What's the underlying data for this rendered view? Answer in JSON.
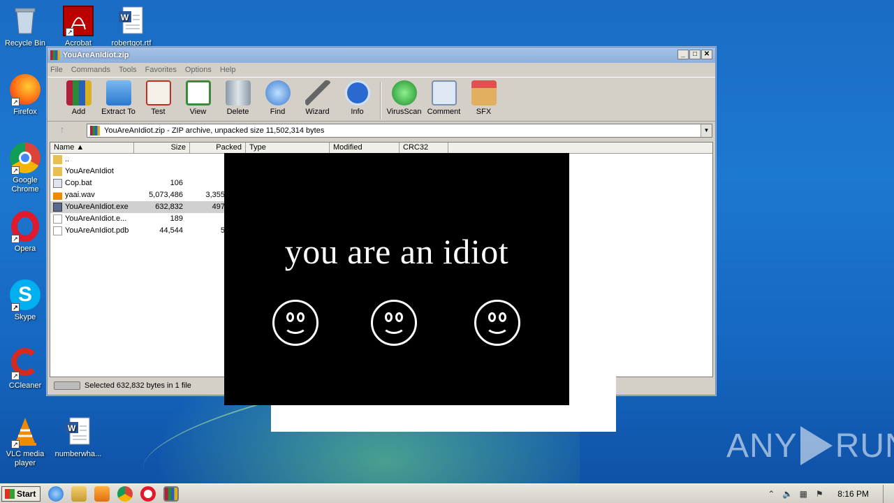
{
  "desktop": {
    "icons": [
      {
        "label": "Recycle Bin"
      },
      {
        "label": "Acrobat"
      },
      {
        "label": "robertgot.rtf"
      },
      {
        "label": "Firefox"
      },
      {
        "label": "Google Chrome"
      },
      {
        "label": "Opera"
      },
      {
        "label": "Skype"
      },
      {
        "label": "CCleaner"
      },
      {
        "label": "VLC media player"
      },
      {
        "label": "numberwha..."
      }
    ]
  },
  "window": {
    "title": "YouAreAnIdiot.zip",
    "menu": [
      "File",
      "Commands",
      "Tools",
      "Favorites",
      "Options",
      "Help"
    ],
    "toolbar": [
      "Add",
      "Extract To",
      "Test",
      "View",
      "Delete",
      "Find",
      "Wizard",
      "Info",
      "VirusScan",
      "Comment",
      "SFX"
    ],
    "address": "YouAreAnIdiot.zip - ZIP archive, unpacked size 11,502,314 bytes",
    "columns": [
      "Name",
      "Size",
      "Packed",
      "Type",
      "Modified",
      "CRC32"
    ],
    "files": [
      {
        "name": "..",
        "size": "",
        "packed": ""
      },
      {
        "name": "YouAreAnIdiot",
        "size": "",
        "packed": ""
      },
      {
        "name": "Cop.bat",
        "size": "106",
        "packed": ""
      },
      {
        "name": "yaai.wav",
        "size": "5,073,486",
        "packed": "3,355"
      },
      {
        "name": "YouAreAnIdiot.exe",
        "size": "632,832",
        "packed": "497"
      },
      {
        "name": "YouAreAnIdiot.e...",
        "size": "189",
        "packed": ""
      },
      {
        "name": "YouAreAnIdiot.pdb",
        "size": "44,544",
        "packed": "5"
      }
    ],
    "status": "Selected 632,832 bytes in 1 file"
  },
  "popup": {
    "message": "you are an idiot"
  },
  "watermark": {
    "left": "ANY",
    "right": "RUN"
  },
  "taskbar": {
    "start_label": "Start",
    "clock": "8:16 PM"
  }
}
